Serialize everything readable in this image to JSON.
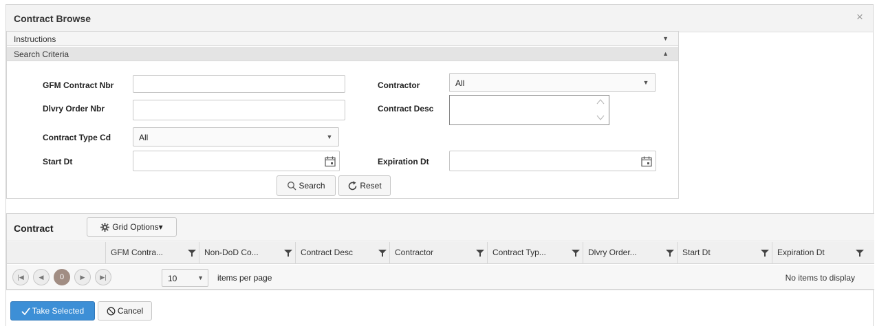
{
  "dialog": {
    "title": "Contract Browse",
    "close_symbol": "×"
  },
  "sections": {
    "instructions": "Instructions",
    "search_criteria": "Search Criteria"
  },
  "form": {
    "gfm_contract_nbr_label": "GFM Contract Nbr",
    "gfm_contract_nbr_value": "",
    "dlvry_order_nbr_label": "Dlvry Order Nbr",
    "dlvry_order_nbr_value": "",
    "contract_type_cd_label": "Contract Type Cd",
    "contract_type_cd_value": "All",
    "start_dt_label": "Start Dt",
    "start_dt_value": "",
    "contractor_label": "Contractor",
    "contractor_value": "All",
    "contract_desc_label": "Contract Desc",
    "contract_desc_value": "",
    "expiration_dt_label": "Expiration Dt",
    "expiration_dt_value": ""
  },
  "buttons": {
    "search": "Search",
    "reset": "Reset",
    "take_selected": "Take Selected",
    "cancel": "Cancel"
  },
  "grid": {
    "title": "Contract",
    "options_label": "Grid Options▾",
    "columns": [
      "GFM Contra...",
      "Non-DoD Co...",
      "Contract Desc",
      "Contractor",
      "Contract Typ...",
      "Dlvry Order...",
      "Start Dt",
      "Expiration Dt"
    ],
    "pager": {
      "current_page": "0",
      "page_size": "10",
      "items_per_page_label": "items per page",
      "status": "No items to display"
    }
  },
  "colors": {
    "primary": "#3d8fd6",
    "current_page": "#a18d83",
    "header_bg": "#f3f3f3"
  }
}
